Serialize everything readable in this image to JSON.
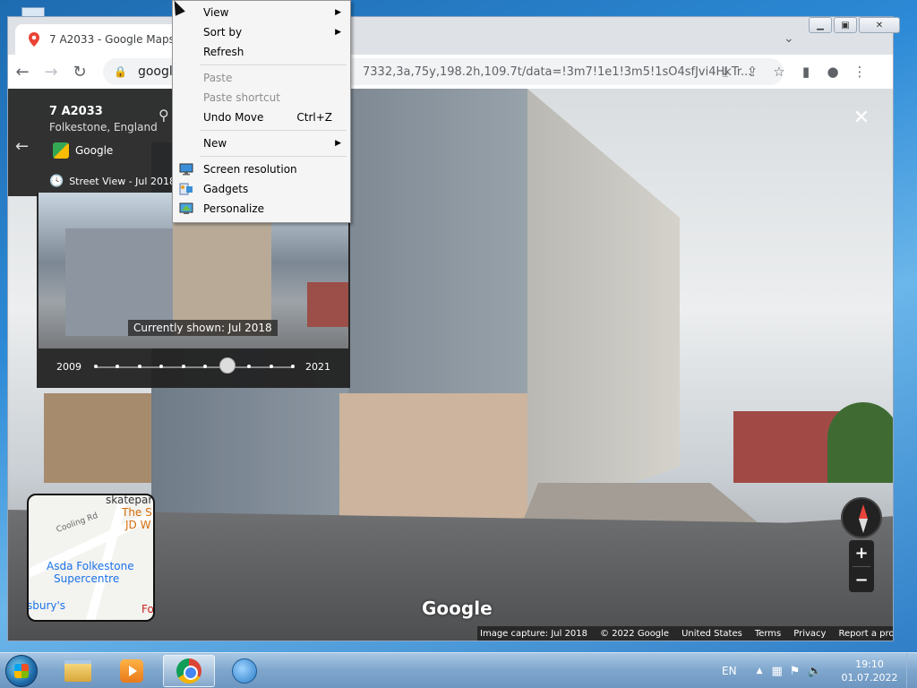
{
  "browser": {
    "tab_title": "7 A2033 - Google Maps",
    "url_host": "google",
    "url_tail": "7332,3a,75y,198.2h,109.7t/data=!3m7!1e1!3m5!1sO4sfJvi4HkTr..."
  },
  "info": {
    "title": "7 A2033",
    "subtitle": "Folkestone, England",
    "source": "Google",
    "history_label": "Street View - Jul 2018"
  },
  "timetravel": {
    "caption": "Currently shown: Jul 2018",
    "start_year": "2009",
    "end_year": "2021",
    "stop_count": 10,
    "selected_index": 6
  },
  "minimap": {
    "labels": [
      "Cooling Rd",
      "skatepark, ...",
      "The S",
      "JD W",
      "Asda Folkestone",
      "Supercentre",
      "sbury's",
      "Fo"
    ]
  },
  "watermark": "Google",
  "footer": [
    "Image capture: Jul 2018",
    "© 2022 Google",
    "United States",
    "Terms",
    "Privacy",
    "Report a problem"
  ],
  "context_menu": {
    "items": [
      {
        "label": "View",
        "submenu": true
      },
      {
        "label": "Sort by",
        "submenu": true
      },
      {
        "label": "Refresh"
      },
      {
        "label": "Paste",
        "disabled": true
      },
      {
        "label": "Paste shortcut",
        "disabled": true
      },
      {
        "label": "Undo Move",
        "shortcut": "Ctrl+Z"
      },
      {
        "label": "New",
        "submenu": true
      },
      {
        "label": "Screen resolution",
        "icon": "monitor-icon"
      },
      {
        "label": "Gadgets",
        "icon": "gadgets-icon"
      },
      {
        "label": "Personalize",
        "icon": "personalize-icon"
      }
    ]
  },
  "taskbar": {
    "lang": "EN",
    "time": "19:10",
    "date": "01.07.2022"
  },
  "colors": {
    "accent": "#1a73e8",
    "panel": "#222222"
  }
}
